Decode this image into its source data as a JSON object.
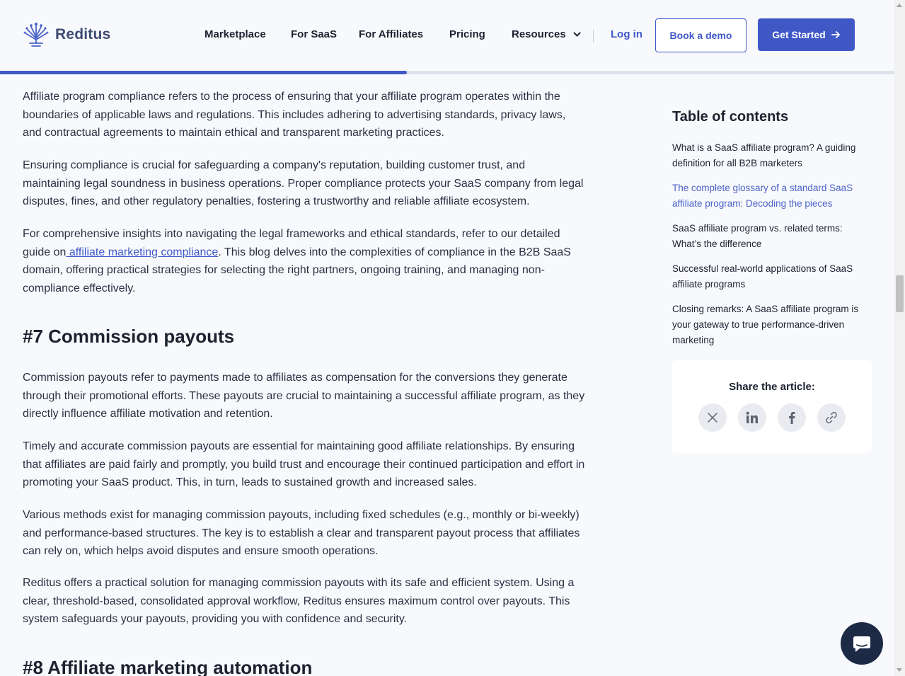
{
  "header": {
    "logo_text": "Reditus",
    "nav": [
      {
        "label": "Marketplace"
      },
      {
        "label": "For SaaS"
      },
      {
        "label": "For Affiliates"
      },
      {
        "label": "Pricing"
      },
      {
        "label": "Resources"
      }
    ],
    "login_label": "Log in",
    "demo_label": "Book a demo",
    "start_label": "Get Started"
  },
  "reading_progress": 0.455,
  "article": {
    "p1": "Affiliate program compliance refers to the process of ensuring that your affiliate program operates within the boundaries of applicable laws and regulations. This includes adhering to advertising standards, privacy laws, and contractual agreements to maintain ethical and transparent marketing practices.",
    "p2": "Ensuring compliance is crucial for safeguarding a company's reputation, building customer trust, and maintaining legal soundness in business operations. Proper compliance protects your SaaS company from legal disputes, fines, and other regulatory penalties, fostering a trustworthy and reliable affiliate ecosystem.",
    "p3_before": "For comprehensive insights into navigating the legal frameworks and ethical standards, refer to our detailed guide on",
    "p3_link": " affiliate marketing compliance",
    "p3_after": ". This blog delves into the complexities of compliance in the B2B SaaS domain, offering practical strategies for selecting the right partners, ongoing training, and managing non-compliance effectively.",
    "h7": "#7 Commission payouts",
    "p4": "Commission payouts refer to payments made to affiliates as compensation for the conversions they generate through their promotional efforts. These payouts are crucial to maintaining a successful affiliate program, as they directly influence affiliate motivation and retention.",
    "p5": "Timely and accurate commission payouts are essential for maintaining good affiliate relationships. By ensuring that affiliates are paid fairly and promptly, you build trust and encourage their continued participation and effort in promoting your SaaS product. This, in turn, leads to sustained growth and increased sales.",
    "p6": "Various methods exist for managing commission payouts, including fixed schedules (e.g., monthly or bi-weekly) and performance-based structures. The key is to establish a clear and transparent payout process that affiliates can rely on, which helps avoid disputes and ensure smooth operations.",
    "p7": "Reditus offers a practical solution for managing commission payouts with its safe and efficient system. Using a clear, threshold-based, consolidated approval workflow, Reditus ensures maximum control over payouts. This system safeguards your payouts, providing you with confidence and security.",
    "h8": "#8 Affiliate marketing automation"
  },
  "toc": {
    "title": "Table of contents",
    "items": [
      {
        "label": "What is a SaaS affiliate program? A guiding definition for all B2B marketers"
      },
      {
        "label": "The complete glossary of a standard SaaS affiliate program: Decoding the pieces"
      },
      {
        "label": "SaaS affiliate program vs. related terms: What’s the difference"
      },
      {
        "label": "Successful real-world applications of SaaS affiliate programs"
      },
      {
        "label": "Closing remarks: A SaaS affiliate program is your gateway to true performance-driven marketing"
      }
    ]
  },
  "share": {
    "title": "Share the article:",
    "buttons": [
      {
        "icon": "x-twitter-icon"
      },
      {
        "icon": "linkedin-icon"
      },
      {
        "icon": "facebook-icon"
      },
      {
        "icon": "link-icon"
      }
    ]
  },
  "colors": {
    "accent": "#4058c6",
    "link": "#3f59c8",
    "toc_active": "#4a63c9",
    "chat": "#1c2a46",
    "background": "#f8f9fc"
  }
}
